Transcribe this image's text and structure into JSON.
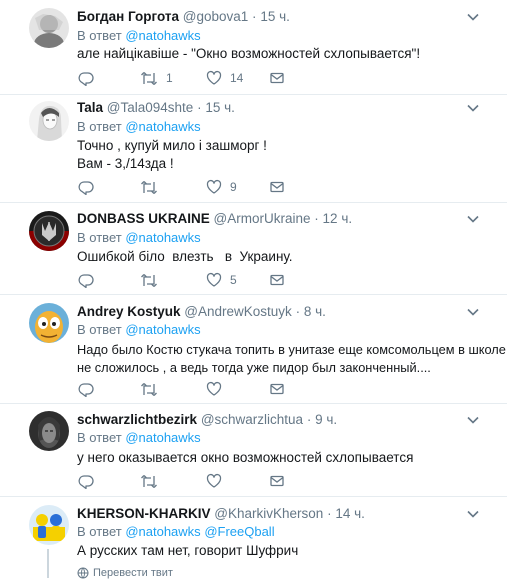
{
  "replies": [
    {
      "name": "Богдан Горгота",
      "handle": "@gobova1",
      "time": "15 ч.",
      "reply_prefix": "В ответ",
      "reply_to": [
        "@natohawks"
      ],
      "lines": [
        "але найцікавіше - \"Окно возможностей схлопывается\"!"
      ],
      "counts": {
        "reply": "",
        "retweet": "1",
        "like": "14"
      }
    },
    {
      "name": "Tala",
      "handle": "@Tala094shte",
      "time": "15 ч.",
      "reply_prefix": "В ответ",
      "reply_to": [
        "@natohawks"
      ],
      "lines": [
        "Точно , купуй мило і зашморг !",
        "Вам - 3,/14зда !"
      ],
      "counts": {
        "reply": "",
        "retweet": "",
        "like": "9"
      }
    },
    {
      "name": "DONBASS UKRAINE",
      "handle": "@ArmorUkraine",
      "time": "12 ч.",
      "reply_prefix": "В ответ",
      "reply_to": [
        "@natohawks"
      ],
      "lines": [
        "Ошибкой біло  влезть   в  Украину."
      ],
      "counts": {
        "reply": "",
        "retweet": "",
        "like": "5"
      }
    },
    {
      "name": "Andrey Kostyuk",
      "handle": "@AndrewKostuyk",
      "time": "8 ч.",
      "reply_prefix": "В ответ",
      "reply_to": [
        "@natohawks"
      ],
      "lines": [
        "Надо было Костю стукача топить в унитазе еще комсомольцем в школе , да",
        "не сложилось , а ведь тогда уже пидор был законченный...."
      ],
      "counts": {
        "reply": "",
        "retweet": "",
        "like": ""
      }
    },
    {
      "name": "schwarzlichtbezirk",
      "handle": "@schwarzlichtua",
      "time": "9 ч.",
      "reply_prefix": "В ответ",
      "reply_to": [
        "@natohawks"
      ],
      "lines": [
        "у него оказывается окно возможностей схлопывается"
      ],
      "counts": {
        "reply": "",
        "retweet": "",
        "like": ""
      }
    },
    {
      "name": "KHERSON-KHARKIV",
      "handle": "@KharkivKherson",
      "time": "14 ч.",
      "reply_prefix": "В ответ",
      "reply_to": [
        "@natohawks",
        "@FreeQball"
      ],
      "lines": [
        "А русских там нет, говорит Шуфрич"
      ],
      "translate": "Перевести твит"
    }
  ],
  "separator": "·",
  "colors": {
    "accent": "#1da1f2",
    "muted": "#657786",
    "text": "#14171a"
  },
  "icons": [
    "reply-icon",
    "retweet-icon",
    "like-icon",
    "message-icon",
    "chevron-down-icon",
    "globe-icon"
  ]
}
